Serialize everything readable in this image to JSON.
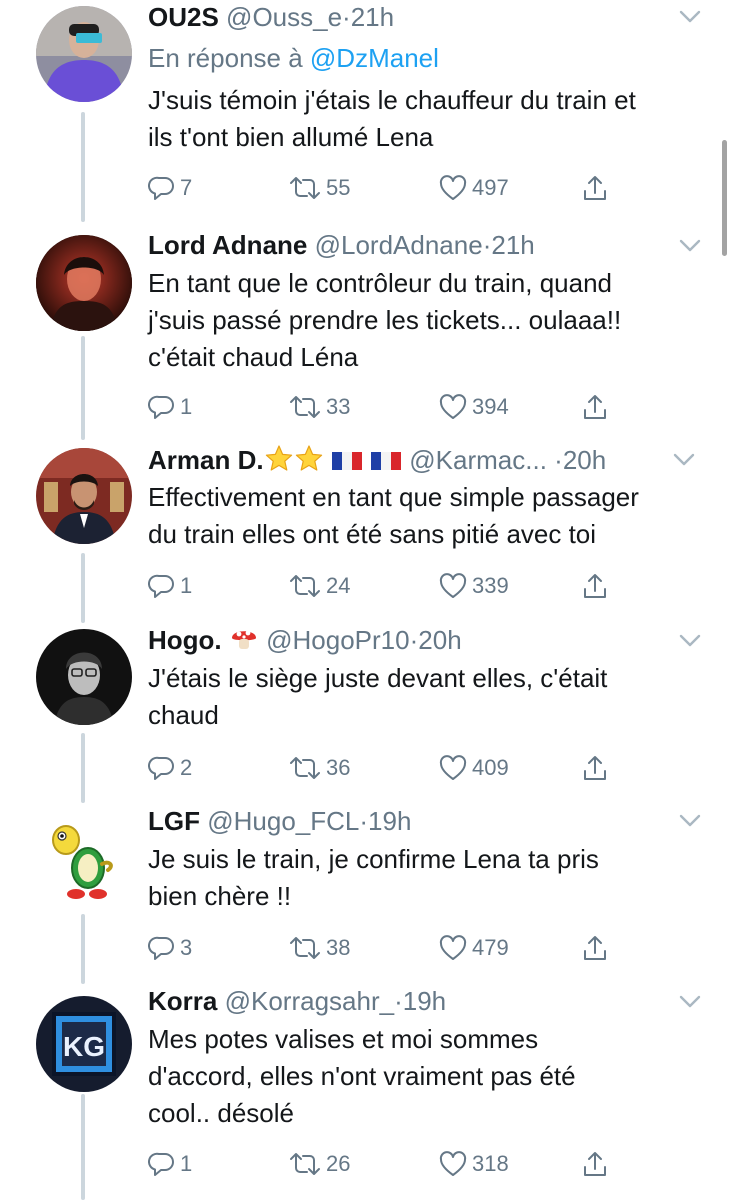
{
  "replies": [
    {
      "name": "OU2S",
      "handle": "@Ouss_e",
      "time": "21h",
      "reply_label": "En réponse à",
      "reply_mention": "@DzManel",
      "text": [
        "J'suis témoin j'étais le chauffeur du train et",
        "ils t'ont bien allumé Lena"
      ],
      "replies": "7",
      "retweets": "55",
      "likes": "497"
    },
    {
      "name": "Lord Adnane",
      "handle": "@LordAdnane",
      "time": "21h",
      "text": [
        "En tant que le contrôleur du train, quand",
        "j'suis passé prendre les tickets... oulaaa!!",
        "c'était chaud Léna"
      ],
      "replies": "1",
      "retweets": "33",
      "likes": "394"
    },
    {
      "name": "Arman D.",
      "handle": "@Karmac...",
      "time": "20h",
      "text": [
        "Effectivement en tant que simple passager",
        "du train elles ont été sans pitié avec toi"
      ],
      "replies": "1",
      "retweets": "24",
      "likes": "339"
    },
    {
      "name": "Hogo.",
      "handle": "@HogoPr10",
      "time": "20h",
      "text": [
        "J'étais le siège juste devant elles, c'était",
        "chaud"
      ],
      "replies": "2",
      "retweets": "36",
      "likes": "409"
    },
    {
      "name": "LGF",
      "handle": "@Hugo_FCL",
      "time": "19h",
      "text": [
        "Je suis le train, je confirme Lena ta pris",
        "bien chère !!"
      ],
      "replies": "3",
      "retweets": "38",
      "likes": "479"
    },
    {
      "name": "Korra",
      "handle": "@Korragsahr_",
      "time": "19h",
      "avatar_text": "KG",
      "text": [
        "Mes potes valises et moi sommes",
        "d'accord, elles n'ont vraiment pas été",
        "cool.. désolé"
      ],
      "replies": "1",
      "retweets": "26",
      "likes": "318"
    }
  ],
  "separator": "·",
  "colors": {
    "text": "#14171a",
    "secondary": "#657786",
    "link": "#1da1f2",
    "thread_line": "#ccd6dd"
  },
  "icons": [
    "reply-icon",
    "retweet-icon",
    "like-icon",
    "share-icon",
    "chevron-down-icon",
    "star-emoji",
    "french-flag-emoji",
    "mushroom-emoji"
  ]
}
